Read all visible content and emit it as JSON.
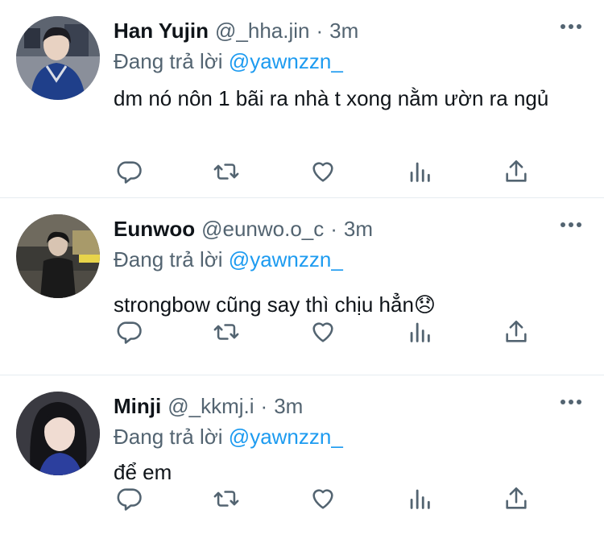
{
  "tweets": [
    {
      "name": "Han Yujin",
      "handle": "@_hha.jin",
      "separator": "·",
      "time": "3m",
      "reply_prefix": "Đang trả lời",
      "reply_to": "@yawnzzn_",
      "text": "dm nó nôn 1 bãi ra nhà t xong nằm ườn ra ngủ"
    },
    {
      "name": "Eunwoo",
      "handle": "@eunwo.o_c",
      "separator": "·",
      "time": "3m",
      "reply_prefix": "Đang trả lời",
      "reply_to": "@yawnzzn_",
      "text": "strongbow cũng say thì chịu hẳn😞"
    },
    {
      "name": "Minji",
      "handle": "@_kkmj.i",
      "separator": "·",
      "time": "3m",
      "reply_prefix": "Đang trả lời",
      "reply_to": "@yawnzzn_",
      "text": "để em"
    }
  ],
  "icons": {
    "reply": "reply-icon",
    "retweet": "retweet-icon",
    "like": "heart-icon",
    "stats": "analytics-icon",
    "share": "share-icon",
    "more": "more-icon"
  },
  "colors": {
    "text": "#0f1419",
    "secondary": "#536471",
    "accent": "#1d9bf0",
    "divider": "#e6ecf0"
  }
}
